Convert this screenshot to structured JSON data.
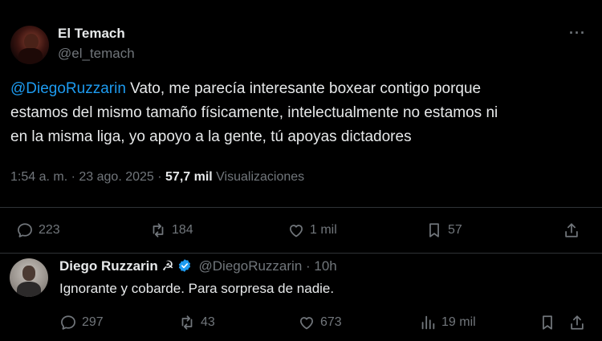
{
  "main_tweet": {
    "author_name": "El Temach",
    "author_handle": "@el_temach",
    "more_label": "···",
    "mention": "@DiegoRuzzarin",
    "text_line1_rest": " Vato, me parecía interesante boxear contigo porque",
    "text_line2": "estamos del mismo tamaño físicamente, intelectualmente no estamos ni",
    "text_line3": "en la misma liga, yo apoyo a la gente, tú apoyas dictadores",
    "time": "1:54 a. m.",
    "separator": " · ",
    "date": "23 ago. 2025",
    "views_count": "57,7 mil",
    "views_label": "Visualizaciones",
    "actions": {
      "replies": "223",
      "retweets": "184",
      "likes": "1 mil",
      "bookmarks": "57"
    }
  },
  "reply_tweet": {
    "author_name": "Diego Ruzzarin",
    "name_emoji": "☭",
    "author_handle": "@DiegoRuzzarin",
    "separator": " · ",
    "time": "10h",
    "text": "Ignorante y cobarde. Para sorpresa de nadie.",
    "actions": {
      "replies": "297",
      "retweets": "43",
      "likes": "673",
      "views": "19 mil"
    }
  },
  "colors": {
    "background": "#000000",
    "text": "#e7e9ea",
    "muted": "#71767b",
    "link": "#1d9bf0",
    "divider": "#2f3336",
    "verified": "#1d9bf0"
  },
  "icons": [
    "reply-icon",
    "retweet-icon",
    "like-icon",
    "bookmark-icon",
    "share-icon",
    "views-icon",
    "verified-badge-icon",
    "more-icon"
  ]
}
